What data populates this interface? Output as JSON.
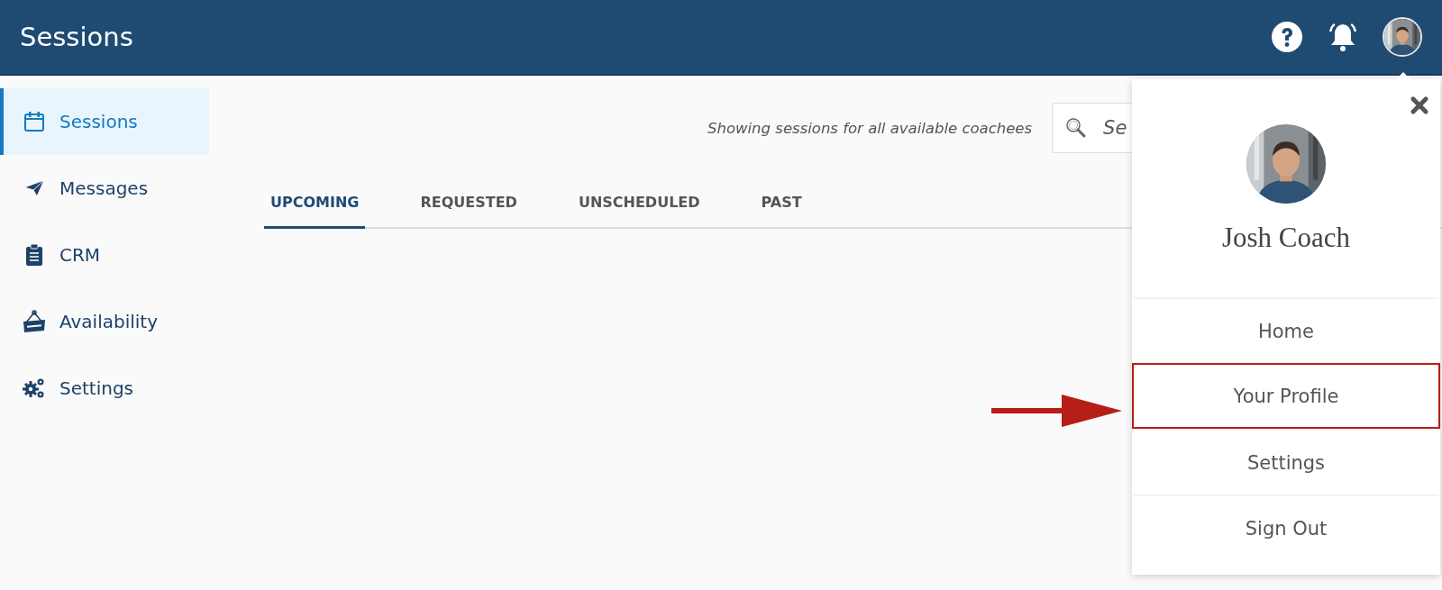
{
  "header": {
    "title": "Sessions"
  },
  "sidebar": {
    "items": [
      {
        "label": "Sessions",
        "kind": "calendar",
        "selected": true
      },
      {
        "label": "Messages",
        "kind": "plane",
        "selected": false
      },
      {
        "label": "CRM",
        "kind": "clipboard",
        "selected": false
      },
      {
        "label": "Availability",
        "kind": "sign",
        "selected": false
      },
      {
        "label": "Settings",
        "kind": "gears",
        "selected": false
      }
    ]
  },
  "filter_note": "Showing sessions for all available coachees",
  "search": {
    "placeholder": "Se"
  },
  "tabs": [
    {
      "label": "UPCOMING",
      "selected": true
    },
    {
      "label": "REQUESTED",
      "selected": false
    },
    {
      "label": "UNSCHEDULED",
      "selected": false
    },
    {
      "label": "PAST",
      "selected": false
    }
  ],
  "profile_menu": {
    "name": "Josh Coach",
    "items": [
      {
        "label": "Home",
        "highlighted": false
      },
      {
        "label": "Your Profile",
        "highlighted": true
      },
      {
        "label": "Settings",
        "highlighted": false
      },
      {
        "label": "Sign Out",
        "highlighted": false
      }
    ]
  }
}
